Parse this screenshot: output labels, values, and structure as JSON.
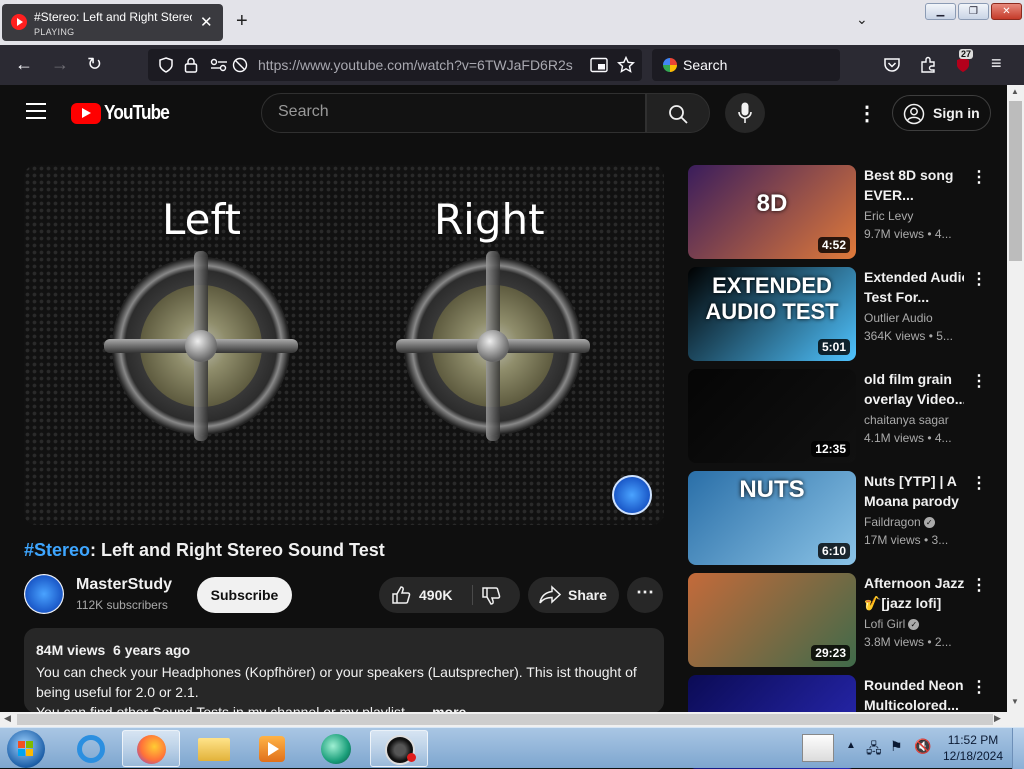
{
  "browser": {
    "tab": {
      "title": "#Stereo: Left and Right Stereo Sound Test",
      "status": "PLAYING"
    },
    "new_tab": "+",
    "url": "https://www.youtube.com/watch?v=6TWJaFD6R2s",
    "search_placeholder": "Search",
    "extensions_badge": "27"
  },
  "youtube": {
    "logo_text": "YouTube",
    "search_placeholder": "Search",
    "sign_in": "Sign in"
  },
  "video": {
    "overlay_left": "Left",
    "overlay_right": "Right",
    "title_tag": "#Stereo",
    "title_rest": ": Left and Right Stereo Sound Test",
    "channel": "MasterStudy",
    "subscribers": "112K subscribers",
    "subscribe_label": "Subscribe",
    "likes": "490K",
    "share_label": "Share",
    "views": "84M views",
    "age": "6 years ago",
    "description_line1": "You can check your Headphones (Kopfhörer) or your speakers (Lautsprecher). This ist thought of being useful for 2.0 or 2.1.",
    "description_line2": "You can find other Sound Tests in my channel or my playlist...",
    "more_label": "...more"
  },
  "recommendations": [
    {
      "title1": "Best 8D song",
      "title2": "EVER...",
      "channel": "Eric Levy",
      "verified": false,
      "meta": "9.7M views • 4...",
      "duration": "4:52",
      "thumb_text": "8D",
      "colors": [
        "#3a1d5c",
        "#e07a3a"
      ]
    },
    {
      "title1": "Extended Audio",
      "title2": "Test For...",
      "channel": "Outlier Audio",
      "verified": false,
      "meta": "364K views • 5...",
      "duration": "5:01",
      "thumb_text": "EXTENDED AUDIO TEST",
      "colors": [
        "#000000",
        "#4fc3ff"
      ]
    },
    {
      "title1": "old film grain",
      "title2": "overlay Video...",
      "channel": "chaitanya sagar",
      "verified": false,
      "meta": "4.1M views • 4...",
      "duration": "12:35",
      "thumb_text": "",
      "colors": [
        "#050505",
        "#111111"
      ]
    },
    {
      "title1": "Nuts [YTP] | A",
      "title2": "Moana parody",
      "channel": "Faildragon",
      "verified": true,
      "meta": "17M views • 3...",
      "duration": "6:10",
      "thumb_text": "NUTS",
      "colors": [
        "#2a6fa8",
        "#8bc3e6"
      ]
    },
    {
      "title1": "Afternoon Jazz",
      "title2": "🎷[jazz lofi]",
      "channel": "Lofi Girl",
      "verified": true,
      "meta": "3.8M views • 2...",
      "duration": "29:23",
      "thumb_text": "",
      "colors": [
        "#c46a3a",
        "#3f6a4a"
      ]
    },
    {
      "title1": "Rounded Neon",
      "title2": "Multicolored...",
      "channel": "",
      "verified": false,
      "meta": "",
      "duration": "",
      "thumb_text": "",
      "colors": [
        "#0b0b55",
        "#2a2ab8"
      ]
    }
  ],
  "taskbar": {
    "time": "11:52 PM",
    "date": "12/18/2024"
  },
  "colors": {
    "brand": "#ff0000",
    "link": "#3ea6ff",
    "background": "#0f0f0f"
  }
}
